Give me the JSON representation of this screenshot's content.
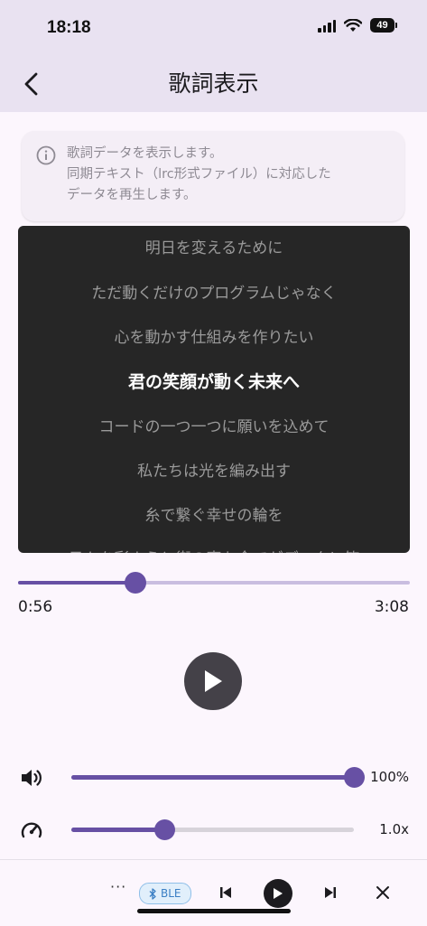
{
  "status_bar": {
    "time": "18:18",
    "battery": "49"
  },
  "app_bar": {
    "title": "歌詞表示"
  },
  "info": {
    "lines": [
      "歌詞データを表示します。",
      "同期テキスト（lrc形式ファイル）に対応した",
      "データを再生します。"
    ]
  },
  "lyrics": {
    "lines": [
      "明日を変えるために",
      "ただ動くだけのプログラムじゃなく",
      "心を動かす仕組みを作りたい",
      "君の笑顔が動く未来へ",
      "コードの一つ一つに願いを込めて",
      "私たちは光を編み出す",
      "糸で繋ぐ幸せの輪を",
      "日々を彩ようと街の声も全てがデータに笑"
    ],
    "current_index": 3
  },
  "playback": {
    "elapsed": "0:56",
    "total": "3:08",
    "progress": 0.3
  },
  "volume": {
    "value_label": "100%",
    "level": 1.0,
    "icon": "volume-icon"
  },
  "speed": {
    "value_label": "1.0x",
    "level": 0.33,
    "icon": "speedometer-icon"
  },
  "mini_player": {
    "more_label": "···",
    "ble_label": "BLE"
  },
  "colors": {
    "accent": "#6750a4",
    "app_bar": "#e9e2f1",
    "lyrics_bg": "#262626"
  }
}
